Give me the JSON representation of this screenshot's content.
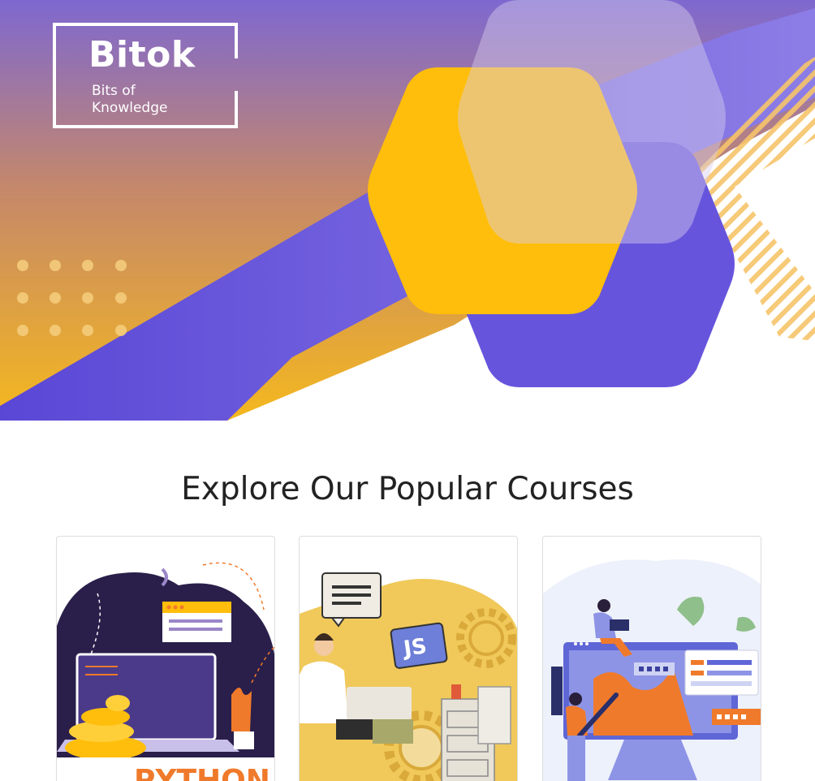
{
  "logo": {
    "title": "Bitok",
    "tagline_line1": "Bits of",
    "tagline_line2": "Knowledge"
  },
  "section": {
    "title": "Explore Our Popular Courses"
  },
  "cards": [
    {
      "name": "python-course-card",
      "illustration_text": "PYTHON"
    },
    {
      "name": "javascript-course-card",
      "illustration_text": "JS"
    },
    {
      "name": "design-course-card"
    }
  ],
  "colors": {
    "purple": "#6a5ad8",
    "yellow": "#ffbe0b",
    "orange": "#f07a2b",
    "dark_navy": "#2a1f4a"
  }
}
